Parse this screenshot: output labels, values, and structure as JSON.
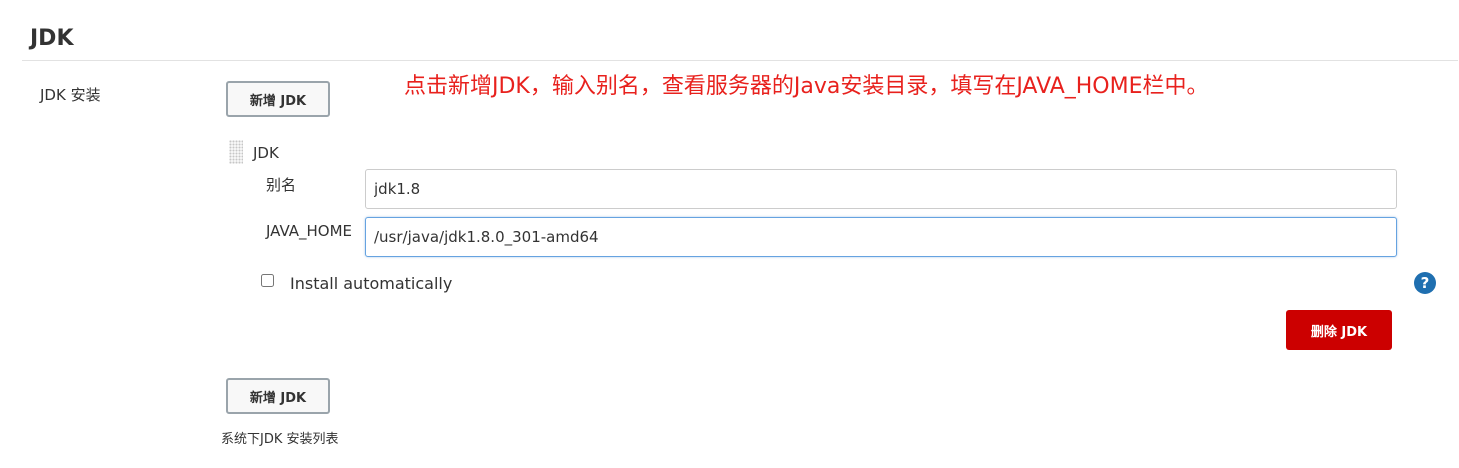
{
  "section": {
    "title": "JDK"
  },
  "jdk_install": {
    "label": "JDK 安装",
    "add_button_label": "新增 JDK",
    "annotation": "点击新增JDK，输入别名，查看服务器的Java安装目录，填写在JAVA_HOME栏中。",
    "entry": {
      "title": "JDK",
      "alias_label": "别名",
      "alias_value": "jdk1.8",
      "java_home_label": "JAVA_HOME",
      "java_home_value": "/usr/java/jdk1.8.0_301-amd64",
      "install_auto_label": "Install automatically",
      "install_auto_checked": false,
      "help_icon": "?",
      "delete_button_label": "删除 JDK"
    },
    "bottom_add_button_label": "新增 JDK",
    "description": "系统下JDK 安装列表"
  },
  "colors": {
    "annotation": "#e8211d",
    "delete_button": "#cc0000",
    "help_icon": "#1f6fb0",
    "focus_border": "#66a3e0"
  }
}
